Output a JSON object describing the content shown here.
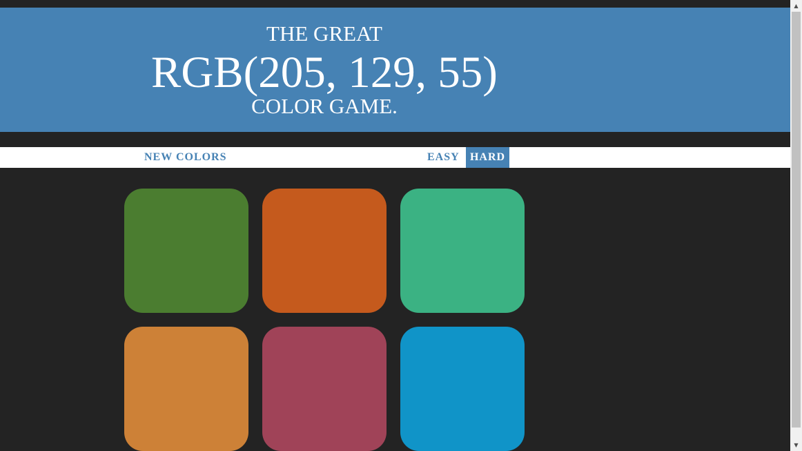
{
  "header": {
    "title_top": "THE GREAT",
    "color_display": "RGB(205, 129, 55)",
    "title_bottom": "COLOR GAME.",
    "background": "#4682b4"
  },
  "controls": {
    "new_colors_label": "NEW COLORS",
    "easy_label": "EASY",
    "hard_label": "HARD",
    "selected_mode": "HARD"
  },
  "squares": [
    {
      "color": "rgb(75, 125, 48)"
    },
    {
      "color": "rgb(197, 90, 29)"
    },
    {
      "color": "rgb(59, 178, 131)"
    },
    {
      "color": "rgb(205, 129, 55)"
    },
    {
      "color": "rgb(160, 67, 88)"
    },
    {
      "color": "rgb(16, 148, 200)"
    }
  ],
  "scrollbar": {
    "up_icon": "chevron-up-icon",
    "down_icon": "chevron-down-icon"
  }
}
